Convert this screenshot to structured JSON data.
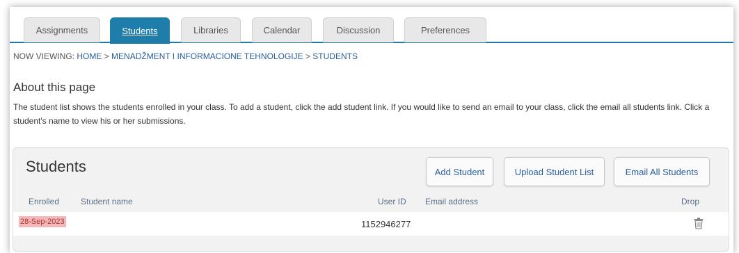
{
  "tabs": [
    {
      "label": "Assignments"
    },
    {
      "label": "Students"
    },
    {
      "label": "Libraries"
    },
    {
      "label": "Calendar"
    },
    {
      "label": "Discussion"
    },
    {
      "label": "Preferences"
    }
  ],
  "active_tab": "Students",
  "breadcrumb": {
    "prefix": "NOW VIEWING: ",
    "home": "HOME",
    "sep": " > ",
    "course": "MENADŽMENT I INFORMACIONE TEHNOLOGIJE",
    "current": "STUDENTS"
  },
  "about": {
    "title": "About this page",
    "text": "The student list shows the students enrolled in your class. To add a student, click the add student link. If you would like to send an email to your class, click the email all students link. Click a student's name to view his or her submissions."
  },
  "students_panel": {
    "title": "Students",
    "buttons": {
      "add": "Add Student",
      "upload": "Upload Student List",
      "email_all": "Email All Students"
    },
    "columns": {
      "enrolled": "Enrolled",
      "name": "Student name",
      "user_id": "User ID",
      "email": "Email address",
      "drop": "Drop"
    },
    "rows": [
      {
        "enrolled": "28-Sep-2023",
        "name": "",
        "user_id": "1152946277",
        "email": ""
      }
    ]
  },
  "icons": {
    "drop": "trash-icon"
  },
  "colors": {
    "active_tab": "#1e7da9",
    "link": "#2a5f9e",
    "highlight": "#f5b8b8"
  }
}
